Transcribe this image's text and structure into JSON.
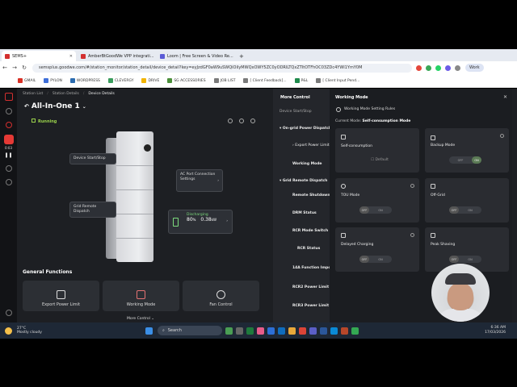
{
  "browser": {
    "tabs": [
      {
        "label": "SEMS+",
        "color": "#d32f2f"
      },
      {
        "label": "AmberBtGoodWe VPP integrati...",
        "color": "#d32f2f"
      },
      {
        "label": "Loom | Free Screen & Video Re...",
        "color": "#5b5bd6"
      }
    ],
    "new_tab": "+",
    "url": "semsplus.goodwe.com/#/station_monitor/station_detail/device_detail?key=eyJzdGF0aW9uSWQiOiIyMWQxOWY5ZC0yODRlLTQxZTItOTFhOC03ZDc4YWI1YmY0M",
    "profile": "Work",
    "bookmarks": [
      {
        "label": "GMAIL",
        "color": "#d93025"
      },
      {
        "label": "PYLON",
        "color": "#3f6fd9"
      },
      {
        "label": "WORDPRESS",
        "color": "#2b6cb0"
      },
      {
        "label": "CLEVERGY",
        "color": "#3a9d5d"
      },
      {
        "label": "DRIVE",
        "color": "#f2b400"
      },
      {
        "label": "SG ACCESSORIES",
        "color": "#4b8f3a"
      },
      {
        "label": "JOB LIST",
        "color": "#7a7a7a"
      },
      {
        "label": "[ Client Feedback]...",
        "color": "#7a7a7a"
      },
      {
        "label": "P&L",
        "color": "#1f8a4c"
      },
      {
        "label": "[ Client Input Pend...",
        "color": "#7a7a7a"
      }
    ]
  },
  "left_nav": {
    "timer": "0:03"
  },
  "breadcrumbs": [
    "Station List",
    "Station Details",
    "Device Details"
  ],
  "device": {
    "title": "All-In-One 1",
    "status": "Running",
    "callouts": {
      "start_stop": "Device Start/Stop",
      "grid_remote": "Grid Remote Dispatch",
      "ac_port": "AC Port Connection Settings",
      "discharging": "Discharging",
      "soc": "80",
      "soc_unit": "%",
      "power": "0.38",
      "power_unit": "kW"
    }
  },
  "general_functions": {
    "title": "General Functions",
    "cards": [
      "Export Power Limit",
      "Working Mode",
      "Fan Control"
    ],
    "more_control": "More Control"
  },
  "more_control": {
    "title": "More Control",
    "items": [
      "Device Start/Stop",
      "On-grid Power Dispatch",
      "Export Power Limit",
      "Working Mode",
      "Grid Remote Dispatch",
      "Remote Shutdown",
      "DRM Status",
      "RCR Mode Switch",
      "RCR Status",
      "14A Function Import",
      "RCR2 Power Limit R",
      "RCR3 Power Limit R"
    ]
  },
  "working_mode": {
    "title": "Working Mode",
    "rules": "Working Mode Setting Rules",
    "current_label": "Current Mode:",
    "current_value": "Self-consumption Mode",
    "modes": [
      {
        "label": "Self-consumption",
        "control": "Default"
      },
      {
        "label": "Backup Mode",
        "control_off": "OFF",
        "control_on": "ON"
      },
      {
        "label": "TOU Mode",
        "control_off": "OFF",
        "control_on": "ON"
      },
      {
        "label": "Off-Grid",
        "control_off": "OFF",
        "control_on": "ON"
      },
      {
        "label": "Delayed Charging",
        "control_off": "OFF",
        "control_on": "ON"
      },
      {
        "label": "Peak Shaving",
        "control_off": "OFF",
        "control_on": "ON"
      }
    ]
  },
  "taskbar": {
    "weather_temp": "27°C",
    "weather_desc": "Mostly cloudy",
    "search": "Search",
    "time": "6:36 AM",
    "date": "17/03/2026"
  }
}
